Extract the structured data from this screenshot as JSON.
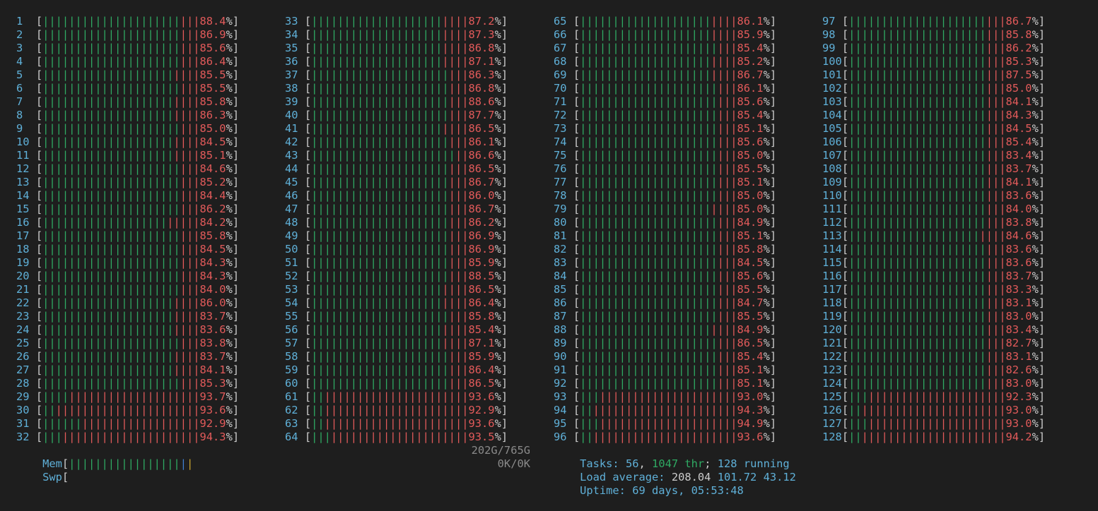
{
  "cpus": [
    {
      "id": "1",
      "g": 21,
      "r": 3,
      "pct": "88.4"
    },
    {
      "id": "2",
      "g": 21,
      "r": 3,
      "pct": "86.9"
    },
    {
      "id": "3",
      "g": 21,
      "r": 3,
      "pct": "85.6"
    },
    {
      "id": "4",
      "g": 21,
      "r": 3,
      "pct": "86.4"
    },
    {
      "id": "5",
      "g": 20,
      "r": 4,
      "pct": "85.5"
    },
    {
      "id": "6",
      "g": 21,
      "r": 3,
      "pct": "85.5"
    },
    {
      "id": "7",
      "g": 20,
      "r": 4,
      "pct": "85.8"
    },
    {
      "id": "8",
      "g": 20,
      "r": 4,
      "pct": "86.3"
    },
    {
      "id": "9",
      "g": 21,
      "r": 3,
      "pct": "85.0"
    },
    {
      "id": "10",
      "g": 20,
      "r": 4,
      "pct": "84.5"
    },
    {
      "id": "11",
      "g": 20,
      "r": 4,
      "pct": "85.1"
    },
    {
      "id": "12",
      "g": 21,
      "r": 3,
      "pct": "84.6"
    },
    {
      "id": "13",
      "g": 21,
      "r": 3,
      "pct": "85.2"
    },
    {
      "id": "14",
      "g": 21,
      "r": 3,
      "pct": "84.4"
    },
    {
      "id": "15",
      "g": 21,
      "r": 3,
      "pct": "86.2"
    },
    {
      "id": "16",
      "g": 19,
      "r": 5,
      "pct": "84.2"
    },
    {
      "id": "17",
      "g": 21,
      "r": 3,
      "pct": "85.8"
    },
    {
      "id": "18",
      "g": 21,
      "r": 3,
      "pct": "84.5"
    },
    {
      "id": "19",
      "g": 21,
      "r": 3,
      "pct": "84.3"
    },
    {
      "id": "20",
      "g": 21,
      "r": 3,
      "pct": "84.3"
    },
    {
      "id": "21",
      "g": 21,
      "r": 3,
      "pct": "84.0"
    },
    {
      "id": "22",
      "g": 20,
      "r": 4,
      "pct": "86.0"
    },
    {
      "id": "23",
      "g": 20,
      "r": 4,
      "pct": "83.7"
    },
    {
      "id": "24",
      "g": 20,
      "r": 4,
      "pct": "83.6"
    },
    {
      "id": "25",
      "g": 21,
      "r": 3,
      "pct": "83.8"
    },
    {
      "id": "26",
      "g": 20,
      "r": 4,
      "pct": "83.7"
    },
    {
      "id": "27",
      "g": 20,
      "r": 4,
      "pct": "84.1"
    },
    {
      "id": "28",
      "g": 21,
      "r": 3,
      "pct": "85.3"
    },
    {
      "id": "29",
      "g": 4,
      "r": 20,
      "pct": "93.7"
    },
    {
      "id": "30",
      "g": 2,
      "r": 22,
      "pct": "93.6"
    },
    {
      "id": "31",
      "g": 6,
      "r": 18,
      "pct": "92.9"
    },
    {
      "id": "32",
      "g": 3,
      "r": 21,
      "pct": "94.3"
    },
    {
      "id": "33",
      "g": 20,
      "r": 4,
      "pct": "87.2"
    },
    {
      "id": "34",
      "g": 20,
      "r": 4,
      "pct": "87.3"
    },
    {
      "id": "35",
      "g": 20,
      "r": 4,
      "pct": "86.8"
    },
    {
      "id": "36",
      "g": 20,
      "r": 4,
      "pct": "87.1"
    },
    {
      "id": "37",
      "g": 21,
      "r": 3,
      "pct": "86.3"
    },
    {
      "id": "38",
      "g": 21,
      "r": 3,
      "pct": "86.8"
    },
    {
      "id": "39",
      "g": 21,
      "r": 3,
      "pct": "88.6"
    },
    {
      "id": "40",
      "g": 21,
      "r": 3,
      "pct": "87.7"
    },
    {
      "id": "41",
      "g": 20,
      "r": 4,
      "pct": "86.5"
    },
    {
      "id": "42",
      "g": 21,
      "r": 3,
      "pct": "86.1"
    },
    {
      "id": "43",
      "g": 22,
      "r": 2,
      "pct": "86.6"
    },
    {
      "id": "44",
      "g": 21,
      "r": 3,
      "pct": "86.5"
    },
    {
      "id": "45",
      "g": 21,
      "r": 3,
      "pct": "86.7"
    },
    {
      "id": "46",
      "g": 21,
      "r": 3,
      "pct": "86.0"
    },
    {
      "id": "47",
      "g": 21,
      "r": 3,
      "pct": "86.7"
    },
    {
      "id": "48",
      "g": 21,
      "r": 3,
      "pct": "86.2"
    },
    {
      "id": "49",
      "g": 21,
      "r": 3,
      "pct": "86.9"
    },
    {
      "id": "50",
      "g": 21,
      "r": 3,
      "pct": "86.9"
    },
    {
      "id": "51",
      "g": 21,
      "r": 3,
      "pct": "85.9"
    },
    {
      "id": "52",
      "g": 21,
      "r": 3,
      "pct": "88.5"
    },
    {
      "id": "53",
      "g": 20,
      "r": 4,
      "pct": "86.5"
    },
    {
      "id": "54",
      "g": 20,
      "r": 4,
      "pct": "86.4"
    },
    {
      "id": "55",
      "g": 21,
      "r": 3,
      "pct": "85.8"
    },
    {
      "id": "56",
      "g": 20,
      "r": 4,
      "pct": "85.4"
    },
    {
      "id": "57",
      "g": 20,
      "r": 4,
      "pct": "87.1"
    },
    {
      "id": "58",
      "g": 21,
      "r": 3,
      "pct": "85.9"
    },
    {
      "id": "59",
      "g": 21,
      "r": 3,
      "pct": "86.4"
    },
    {
      "id": "60",
      "g": 21,
      "r": 3,
      "pct": "86.5"
    },
    {
      "id": "61",
      "g": 2,
      "r": 22,
      "pct": "93.6"
    },
    {
      "id": "62",
      "g": 2,
      "r": 22,
      "pct": "92.9"
    },
    {
      "id": "63",
      "g": 2,
      "r": 22,
      "pct": "93.6"
    },
    {
      "id": "64",
      "g": 3,
      "r": 21,
      "pct": "93.5"
    },
    {
      "id": "65",
      "g": 20,
      "r": 4,
      "pct": "86.1"
    },
    {
      "id": "66",
      "g": 20,
      "r": 4,
      "pct": "85.9"
    },
    {
      "id": "67",
      "g": 21,
      "r": 3,
      "pct": "85.4"
    },
    {
      "id": "68",
      "g": 20,
      "r": 4,
      "pct": "85.2"
    },
    {
      "id": "69",
      "g": 20,
      "r": 4,
      "pct": "86.7"
    },
    {
      "id": "70",
      "g": 21,
      "r": 3,
      "pct": "86.1"
    },
    {
      "id": "71",
      "g": 21,
      "r": 3,
      "pct": "85.6"
    },
    {
      "id": "72",
      "g": 21,
      "r": 3,
      "pct": "85.4"
    },
    {
      "id": "73",
      "g": 21,
      "r": 3,
      "pct": "85.1"
    },
    {
      "id": "74",
      "g": 21,
      "r": 3,
      "pct": "85.6"
    },
    {
      "id": "75",
      "g": 21,
      "r": 3,
      "pct": "85.0"
    },
    {
      "id": "76",
      "g": 21,
      "r": 3,
      "pct": "85.5"
    },
    {
      "id": "77",
      "g": 21,
      "r": 3,
      "pct": "85.1"
    },
    {
      "id": "78",
      "g": 21,
      "r": 3,
      "pct": "85.0"
    },
    {
      "id": "79",
      "g": 20,
      "r": 4,
      "pct": "85.0"
    },
    {
      "id": "80",
      "g": 21,
      "r": 3,
      "pct": "84.9"
    },
    {
      "id": "81",
      "g": 21,
      "r": 3,
      "pct": "85.1"
    },
    {
      "id": "82",
      "g": 21,
      "r": 3,
      "pct": "85.8"
    },
    {
      "id": "83",
      "g": 21,
      "r": 3,
      "pct": "84.5"
    },
    {
      "id": "84",
      "g": 21,
      "r": 3,
      "pct": "85.6"
    },
    {
      "id": "85",
      "g": 21,
      "r": 3,
      "pct": "85.5"
    },
    {
      "id": "86",
      "g": 21,
      "r": 3,
      "pct": "84.7"
    },
    {
      "id": "87",
      "g": 21,
      "r": 3,
      "pct": "85.5"
    },
    {
      "id": "88",
      "g": 20,
      "r": 4,
      "pct": "84.9"
    },
    {
      "id": "89",
      "g": 21,
      "r": 3,
      "pct": "86.5"
    },
    {
      "id": "90",
      "g": 21,
      "r": 3,
      "pct": "85.4"
    },
    {
      "id": "91",
      "g": 21,
      "r": 3,
      "pct": "85.1"
    },
    {
      "id": "92",
      "g": 21,
      "r": 3,
      "pct": "85.1"
    },
    {
      "id": "93",
      "g": 3,
      "r": 21,
      "pct": "93.0"
    },
    {
      "id": "94",
      "g": 2,
      "r": 22,
      "pct": "94.3"
    },
    {
      "id": "95",
      "g": 3,
      "r": 21,
      "pct": "94.9"
    },
    {
      "id": "96",
      "g": 2,
      "r": 22,
      "pct": "93.6"
    },
    {
      "id": "97",
      "g": 21,
      "r": 3,
      "pct": "86.7"
    },
    {
      "id": "98",
      "g": 21,
      "r": 3,
      "pct": "85.8"
    },
    {
      "id": "99",
      "g": 21,
      "r": 3,
      "pct": "86.2"
    },
    {
      "id": "100",
      "g": 21,
      "r": 3,
      "pct": "85.3"
    },
    {
      "id": "101",
      "g": 21,
      "r": 3,
      "pct": "87.5"
    },
    {
      "id": "102",
      "g": 21,
      "r": 3,
      "pct": "85.0"
    },
    {
      "id": "103",
      "g": 21,
      "r": 3,
      "pct": "84.1"
    },
    {
      "id": "104",
      "g": 21,
      "r": 3,
      "pct": "84.3"
    },
    {
      "id": "105",
      "g": 21,
      "r": 3,
      "pct": "84.5"
    },
    {
      "id": "106",
      "g": 21,
      "r": 3,
      "pct": "85.4"
    },
    {
      "id": "107",
      "g": 21,
      "r": 3,
      "pct": "83.4"
    },
    {
      "id": "108",
      "g": 21,
      "r": 3,
      "pct": "83.7"
    },
    {
      "id": "109",
      "g": 21,
      "r": 3,
      "pct": "84.1"
    },
    {
      "id": "110",
      "g": 21,
      "r": 3,
      "pct": "83.6"
    },
    {
      "id": "111",
      "g": 21,
      "r": 3,
      "pct": "84.0"
    },
    {
      "id": "112",
      "g": 21,
      "r": 3,
      "pct": "83.8"
    },
    {
      "id": "113",
      "g": 20,
      "r": 4,
      "pct": "84.6"
    },
    {
      "id": "114",
      "g": 21,
      "r": 3,
      "pct": "83.6"
    },
    {
      "id": "115",
      "g": 21,
      "r": 3,
      "pct": "83.6"
    },
    {
      "id": "116",
      "g": 21,
      "r": 3,
      "pct": "83.7"
    },
    {
      "id": "117",
      "g": 21,
      "r": 3,
      "pct": "83.3"
    },
    {
      "id": "118",
      "g": 21,
      "r": 3,
      "pct": "83.1"
    },
    {
      "id": "119",
      "g": 21,
      "r": 3,
      "pct": "83.0"
    },
    {
      "id": "120",
      "g": 21,
      "r": 3,
      "pct": "83.4"
    },
    {
      "id": "121",
      "g": 21,
      "r": 3,
      "pct": "82.7"
    },
    {
      "id": "122",
      "g": 21,
      "r": 3,
      "pct": "83.1"
    },
    {
      "id": "123",
      "g": 21,
      "r": 3,
      "pct": "82.6"
    },
    {
      "id": "124",
      "g": 21,
      "r": 3,
      "pct": "83.0"
    },
    {
      "id": "125",
      "g": 3,
      "r": 21,
      "pct": "92.3"
    },
    {
      "id": "126",
      "g": 2,
      "r": 22,
      "pct": "93.0"
    },
    {
      "id": "127",
      "g": 3,
      "r": 21,
      "pct": "93.0"
    },
    {
      "id": "128",
      "g": 2,
      "r": 22,
      "pct": "94.2"
    }
  ],
  "mem": {
    "label": "Mem",
    "g": 17,
    "b": 1,
    "y": 1,
    "value": "202G/765G"
  },
  "swp": {
    "label": "Swp",
    "value": "0K/0K"
  },
  "tasks": {
    "prefix": "Tasks: ",
    "count": "56",
    "sep1": ", ",
    "threads": "1047",
    "thr_label": " thr",
    "sep2": "; ",
    "running": "128",
    "run_label": " running"
  },
  "load": {
    "prefix": "Load average: ",
    "l1": "208.04",
    "l5": "101.72",
    "l15": "43.12"
  },
  "uptime": {
    "prefix": "Uptime: ",
    "value": "69 days, 05:53:48"
  },
  "colors": {
    "background": "#1e1e1e",
    "bar_green": "#2faa63",
    "bar_red": "#e25a5a",
    "label_cyan": "#5fb0d8"
  }
}
